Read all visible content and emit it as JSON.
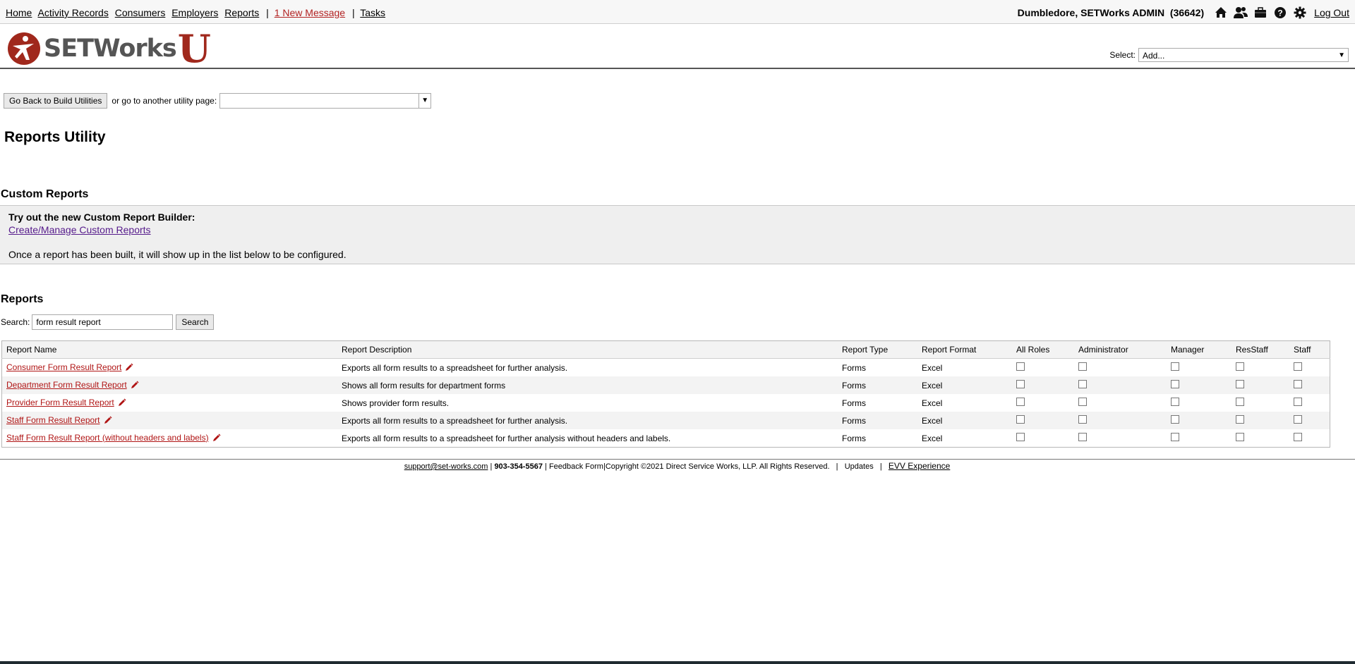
{
  "nav": {
    "items": [
      "Home",
      "Activity Records",
      "Consumers",
      "Employers",
      "Reports"
    ],
    "message": "1 New Message",
    "tasks": "Tasks",
    "separator": "|"
  },
  "user": {
    "name": "Dumbledore, SETWorks ADMIN",
    "id": "(36642)",
    "icons": [
      "home-icon",
      "users-icon",
      "briefcase-icon",
      "help-icon",
      "gear-icon"
    ],
    "logout": "Log Out"
  },
  "header": {
    "logo_text": "SETWorks",
    "logo_u": "U",
    "select_label": "Select:",
    "select_value": "Add..."
  },
  "utility": {
    "back_button": "Go Back to Build Utilities",
    "goto_label": "or go to another utility page:"
  },
  "page_title": "Reports Utility",
  "custom_reports": {
    "heading": "Custom Reports",
    "tryout": "Try out the new Custom Report Builder:",
    "link": "Create/Manage Custom Reports",
    "note": "Once a report has been built, it will show up in the list below to be configured."
  },
  "reports": {
    "heading": "Reports",
    "search_label": "Search:",
    "search_value": "form result report",
    "search_button": "Search",
    "columns": [
      "Report Name",
      "Report Description",
      "Report Type",
      "Report Format",
      "All Roles",
      "Administrator",
      "Manager",
      "ResStaff",
      "Staff"
    ],
    "rows": [
      {
        "name": "Consumer Form Result Report",
        "desc": "Exports all form results to a spreadsheet for further analysis.",
        "type": "Forms",
        "format": "Excel"
      },
      {
        "name": "Department Form Result Report",
        "desc": "Shows all form results for department forms",
        "type": "Forms",
        "format": "Excel"
      },
      {
        "name": "Provider Form Result Report",
        "desc": "Shows provider form results.",
        "type": "Forms",
        "format": "Excel"
      },
      {
        "name": "Staff Form Result Report",
        "desc": "Exports all form results to a spreadsheet for further analysis.",
        "type": "Forms",
        "format": "Excel"
      },
      {
        "name": "Staff Form Result Report (without headers and labels)",
        "desc": "Exports all form results to a spreadsheet for further analysis without headers and labels.",
        "type": "Forms",
        "format": "Excel"
      }
    ]
  },
  "footer": {
    "email": "support@set-works.com",
    "phone": "903-354-5567",
    "feedback": "Feedback Form",
    "copyright": "Copyright ©2021 Direct Service Works, LLP. All Rights Reserved.",
    "updates": "Updates",
    "evv": "EVV Experience"
  },
  "colors": {
    "brand_red": "#a0281c",
    "link_red": "#b01515",
    "message_red": "#b22222"
  }
}
